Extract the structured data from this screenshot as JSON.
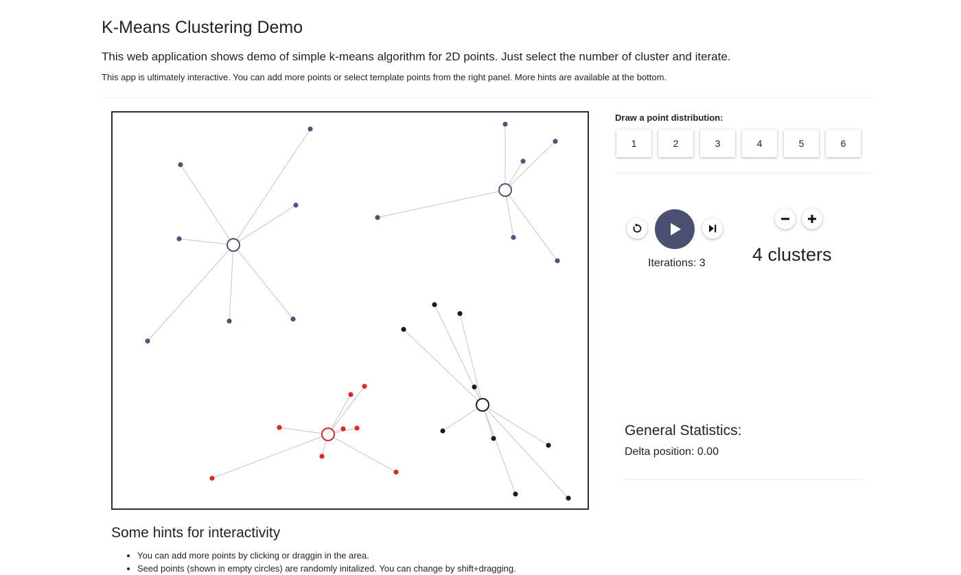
{
  "header": {
    "title": "K-Means Clustering Demo",
    "lead": "This web application shows demo of simple k-means algorithm for 2D points. Just select the number of cluster and iterate.",
    "sub": "This app is ultimately interactive. You can add more points or select template points from the right panel. More hints are available at the bottom."
  },
  "panel": {
    "distribution_label": "Draw a point distribution:",
    "distribution_buttons": [
      "1",
      "2",
      "3",
      "4",
      "5",
      "6"
    ],
    "iterations_text": "Iterations: 3",
    "clusters_text": "4 clusters"
  },
  "stats": {
    "title": "General Statistics:",
    "delta": "Delta position: 0.00"
  },
  "hints": {
    "title": "Some hints for interactivity",
    "items": [
      "You can add more points by clicking or draggin in the area.",
      "Seed points (shown in empty circles) are randomly initalized. You can change by shift+dragging."
    ]
  },
  "icons": {
    "reset": "reset-icon",
    "play": "play-icon",
    "step": "step-forward-icon",
    "minus": "minus-icon",
    "plus": "plus-icon"
  },
  "colors": {
    "cluster_blue": "#4b5578",
    "cluster_red": "#e0262a",
    "cluster_black": "#1c1c1c",
    "play_button": "#4b5070"
  }
}
